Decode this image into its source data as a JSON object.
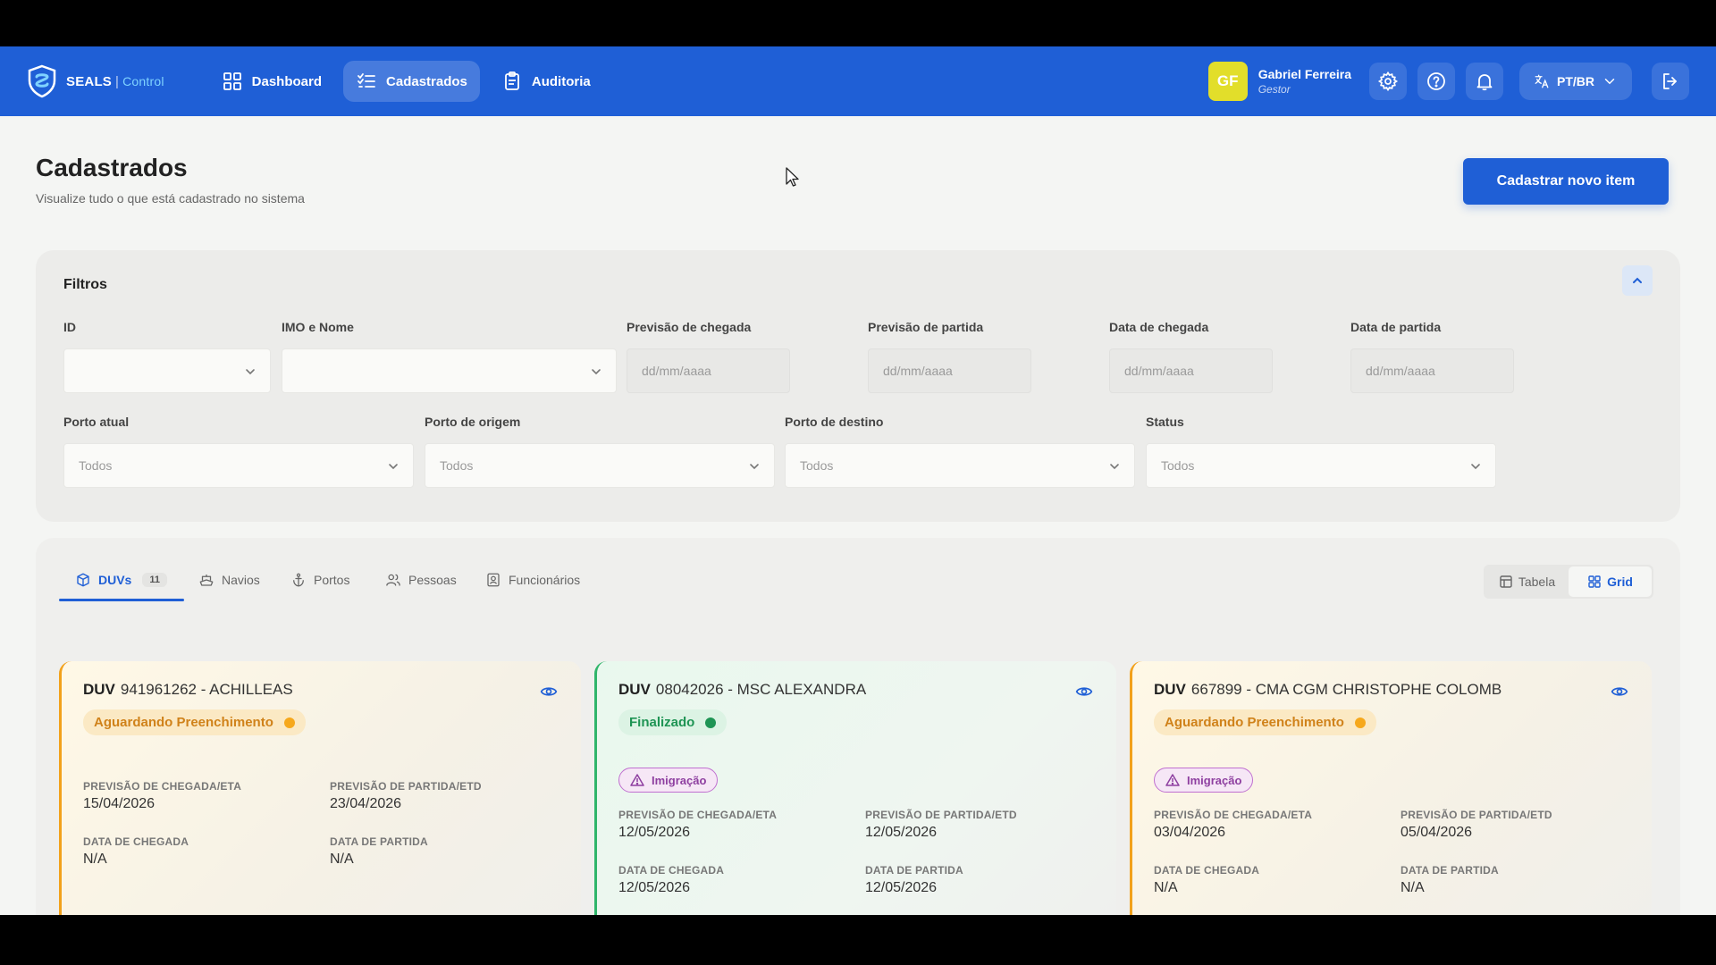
{
  "app": {
    "brand": "SEALS",
    "brand_sub": "Control"
  },
  "nav": {
    "items": [
      {
        "label": "Dashboard"
      },
      {
        "label": "Cadastrados"
      },
      {
        "label": "Auditoria"
      }
    ]
  },
  "user": {
    "initials": "GF",
    "name": "Gabriel Ferreira",
    "role": "Gestor",
    "language": "PT/BR"
  },
  "page": {
    "title": "Cadastrados",
    "subtitle": "Visualize tudo o que está cadastrado no sistema",
    "primary_action": "Cadastrar novo item"
  },
  "filters": {
    "title": "Filtros",
    "id_label": "ID",
    "imo_label": "IMO e Nome",
    "eta_label": "Previsão de chegada",
    "etd_label": "Previsão de partida",
    "arrival_label": "Data de chegada",
    "departure_label": "Data de partida",
    "date_placeholder": "dd/mm/aaaa",
    "current_port_label": "Porto atual",
    "origin_port_label": "Porto de origem",
    "dest_port_label": "Porto de destino",
    "status_label": "Status",
    "all_value": "Todos"
  },
  "tabs": {
    "duvs": "DUVs",
    "duvs_count": "11",
    "ships": "Navios",
    "ports": "Portos",
    "people": "Pessoas",
    "employees": "Funcionários"
  },
  "view": {
    "table": "Tabela",
    "grid": "Grid"
  },
  "labels": {
    "duv": "DUV",
    "eta": "PREVISÃO DE CHEGADA/ETA",
    "etd": "PREVISÃO DE PARTIDA/ETD",
    "arrival": "DATA DE CHEGADA",
    "departure": "DATA DE PARTIDA"
  },
  "cards": [
    {
      "id": "941961262 - ACHILLEAS",
      "status": "Aguardando Preenchimento",
      "eta": "15/04/2026",
      "etd": "23/04/2026",
      "arrival": "N/A",
      "departure": "N/A"
    },
    {
      "id": "08042026 - MSC ALEXANDRA",
      "status": "Finalizado",
      "tag": "Imigração",
      "eta": "12/05/2026",
      "etd": "12/05/2026",
      "arrival": "12/05/2026",
      "departure": "12/05/2026"
    },
    {
      "id": "667899 - CMA CGM CHRISTOPHE COLOMB",
      "status": "Aguardando Preenchimento",
      "tag": "Imigração",
      "eta": "03/04/2026",
      "etd": "05/04/2026",
      "arrival": "N/A",
      "departure": "N/A"
    }
  ],
  "colors": {
    "primary": "#1f5fd6",
    "pending": "#f2a11b",
    "done": "#2fb56a",
    "tag": "#8e3fa0"
  }
}
